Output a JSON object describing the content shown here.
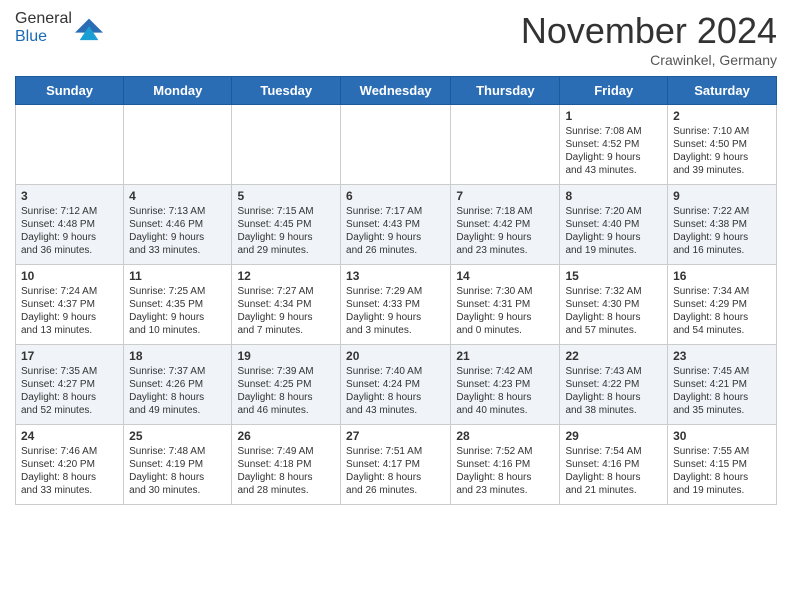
{
  "header": {
    "logo_general": "General",
    "logo_blue": "Blue",
    "month_title": "November 2024",
    "location": "Crawinkel, Germany"
  },
  "calendar": {
    "days_of_week": [
      "Sunday",
      "Monday",
      "Tuesday",
      "Wednesday",
      "Thursday",
      "Friday",
      "Saturday"
    ],
    "weeks": [
      {
        "days": [
          {
            "date": "",
            "info": ""
          },
          {
            "date": "",
            "info": ""
          },
          {
            "date": "",
            "info": ""
          },
          {
            "date": "",
            "info": ""
          },
          {
            "date": "",
            "info": ""
          },
          {
            "date": "1",
            "info": "Sunrise: 7:08 AM\nSunset: 4:52 PM\nDaylight: 9 hours\nand 43 minutes."
          },
          {
            "date": "2",
            "info": "Sunrise: 7:10 AM\nSunset: 4:50 PM\nDaylight: 9 hours\nand 39 minutes."
          }
        ]
      },
      {
        "days": [
          {
            "date": "3",
            "info": "Sunrise: 7:12 AM\nSunset: 4:48 PM\nDaylight: 9 hours\nand 36 minutes."
          },
          {
            "date": "4",
            "info": "Sunrise: 7:13 AM\nSunset: 4:46 PM\nDaylight: 9 hours\nand 33 minutes."
          },
          {
            "date": "5",
            "info": "Sunrise: 7:15 AM\nSunset: 4:45 PM\nDaylight: 9 hours\nand 29 minutes."
          },
          {
            "date": "6",
            "info": "Sunrise: 7:17 AM\nSunset: 4:43 PM\nDaylight: 9 hours\nand 26 minutes."
          },
          {
            "date": "7",
            "info": "Sunrise: 7:18 AM\nSunset: 4:42 PM\nDaylight: 9 hours\nand 23 minutes."
          },
          {
            "date": "8",
            "info": "Sunrise: 7:20 AM\nSunset: 4:40 PM\nDaylight: 9 hours\nand 19 minutes."
          },
          {
            "date": "9",
            "info": "Sunrise: 7:22 AM\nSunset: 4:38 PM\nDaylight: 9 hours\nand 16 minutes."
          }
        ]
      },
      {
        "days": [
          {
            "date": "10",
            "info": "Sunrise: 7:24 AM\nSunset: 4:37 PM\nDaylight: 9 hours\nand 13 minutes."
          },
          {
            "date": "11",
            "info": "Sunrise: 7:25 AM\nSunset: 4:35 PM\nDaylight: 9 hours\nand 10 minutes."
          },
          {
            "date": "12",
            "info": "Sunrise: 7:27 AM\nSunset: 4:34 PM\nDaylight: 9 hours\nand 7 minutes."
          },
          {
            "date": "13",
            "info": "Sunrise: 7:29 AM\nSunset: 4:33 PM\nDaylight: 9 hours\nand 3 minutes."
          },
          {
            "date": "14",
            "info": "Sunrise: 7:30 AM\nSunset: 4:31 PM\nDaylight: 9 hours\nand 0 minutes."
          },
          {
            "date": "15",
            "info": "Sunrise: 7:32 AM\nSunset: 4:30 PM\nDaylight: 8 hours\nand 57 minutes."
          },
          {
            "date": "16",
            "info": "Sunrise: 7:34 AM\nSunset: 4:29 PM\nDaylight: 8 hours\nand 54 minutes."
          }
        ]
      },
      {
        "days": [
          {
            "date": "17",
            "info": "Sunrise: 7:35 AM\nSunset: 4:27 PM\nDaylight: 8 hours\nand 52 minutes."
          },
          {
            "date": "18",
            "info": "Sunrise: 7:37 AM\nSunset: 4:26 PM\nDaylight: 8 hours\nand 49 minutes."
          },
          {
            "date": "19",
            "info": "Sunrise: 7:39 AM\nSunset: 4:25 PM\nDaylight: 8 hours\nand 46 minutes."
          },
          {
            "date": "20",
            "info": "Sunrise: 7:40 AM\nSunset: 4:24 PM\nDaylight: 8 hours\nand 43 minutes."
          },
          {
            "date": "21",
            "info": "Sunrise: 7:42 AM\nSunset: 4:23 PM\nDaylight: 8 hours\nand 40 minutes."
          },
          {
            "date": "22",
            "info": "Sunrise: 7:43 AM\nSunset: 4:22 PM\nDaylight: 8 hours\nand 38 minutes."
          },
          {
            "date": "23",
            "info": "Sunrise: 7:45 AM\nSunset: 4:21 PM\nDaylight: 8 hours\nand 35 minutes."
          }
        ]
      },
      {
        "days": [
          {
            "date": "24",
            "info": "Sunrise: 7:46 AM\nSunset: 4:20 PM\nDaylight: 8 hours\nand 33 minutes."
          },
          {
            "date": "25",
            "info": "Sunrise: 7:48 AM\nSunset: 4:19 PM\nDaylight: 8 hours\nand 30 minutes."
          },
          {
            "date": "26",
            "info": "Sunrise: 7:49 AM\nSunset: 4:18 PM\nDaylight: 8 hours\nand 28 minutes."
          },
          {
            "date": "27",
            "info": "Sunrise: 7:51 AM\nSunset: 4:17 PM\nDaylight: 8 hours\nand 26 minutes."
          },
          {
            "date": "28",
            "info": "Sunrise: 7:52 AM\nSunset: 4:16 PM\nDaylight: 8 hours\nand 23 minutes."
          },
          {
            "date": "29",
            "info": "Sunrise: 7:54 AM\nSunset: 4:16 PM\nDaylight: 8 hours\nand 21 minutes."
          },
          {
            "date": "30",
            "info": "Sunrise: 7:55 AM\nSunset: 4:15 PM\nDaylight: 8 hours\nand 19 minutes."
          }
        ]
      }
    ]
  }
}
